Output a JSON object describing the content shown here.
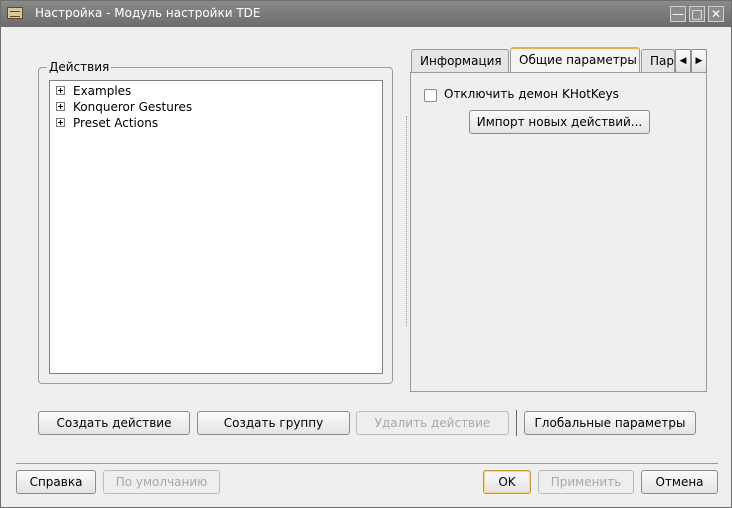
{
  "window": {
    "title": "Настройка - Модуль настройки TDE",
    "icon": "keyboard-icon",
    "controls": [
      "minimize-icon",
      "maximize-icon",
      "close-icon"
    ]
  },
  "actions_group": {
    "title": "Действия",
    "tree_items": [
      {
        "label": "Examples",
        "expanded": false
      },
      {
        "label": "Konqueror Gestures",
        "expanded": false
      },
      {
        "label": "Preset Actions",
        "expanded": false
      }
    ]
  },
  "tabs": {
    "items": [
      "Информация",
      "Общие параметры",
      "Пара"
    ],
    "active": "Общие параметры",
    "scroll_left_icon": "arrow-left-icon",
    "scroll_right_icon": "arrow-right-icon"
  },
  "general_tab": {
    "disable_daemon_label": "Отключить демон KHotKeys",
    "disable_daemon_checked": false,
    "import_button": "Импорт новых действий..."
  },
  "action_buttons": {
    "create_action": "Создать действие",
    "create_group": "Создать группу",
    "delete_action": "Удалить действие",
    "global_settings": "Глобальные параметры"
  },
  "dialog_buttons": {
    "help": "Справка",
    "defaults": "По умолчанию",
    "ok": "OK",
    "apply": "Применить",
    "cancel": "Отмена"
  }
}
